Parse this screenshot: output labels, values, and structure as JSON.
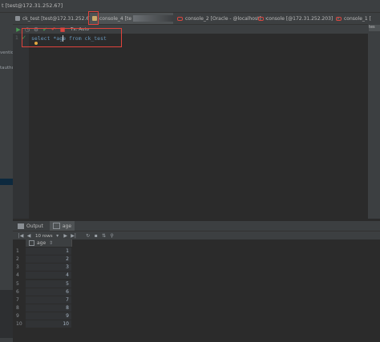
{
  "window": {
    "title": "t [test@172.31.252.67]"
  },
  "left_panel": {
    "item_partial_1": "ventio",
    "item_partial_2": "tautho"
  },
  "tabs": [
    {
      "label": "ck_test [test@172.31.252.67]",
      "active": false
    },
    {
      "label": "console_4 [te",
      "active": true
    },
    {
      "label": "console_2 [Oracle - @localhost]",
      "active": false
    },
    {
      "label": "console [@172.31.252.203]",
      "active": false
    },
    {
      "label": "console_1 [",
      "active": false
    }
  ],
  "right_tab_partial": "tes",
  "toolbar": {
    "tx_mode": "Tx: Auto"
  },
  "editor": {
    "line_number": "1",
    "query": "select *age from ck_test"
  },
  "output": {
    "tabs": [
      {
        "label": "Output"
      },
      {
        "label": "age"
      }
    ],
    "rows_selector": "10 rows",
    "column_header": "age",
    "rows": [
      {
        "n": "1",
        "age": "1"
      },
      {
        "n": "2",
        "age": "2"
      },
      {
        "n": "3",
        "age": "3"
      },
      {
        "n": "4",
        "age": "4"
      },
      {
        "n": "5",
        "age": "5"
      },
      {
        "n": "6",
        "age": "6"
      },
      {
        "n": "7",
        "age": "7"
      },
      {
        "n": "8",
        "age": "8"
      },
      {
        "n": "9",
        "age": "9"
      },
      {
        "n": "10",
        "age": "10"
      }
    ]
  },
  "colors": {
    "accent_red": "#e0433b",
    "run_green": "#499c54",
    "keyword_blue": "#6897bb"
  }
}
